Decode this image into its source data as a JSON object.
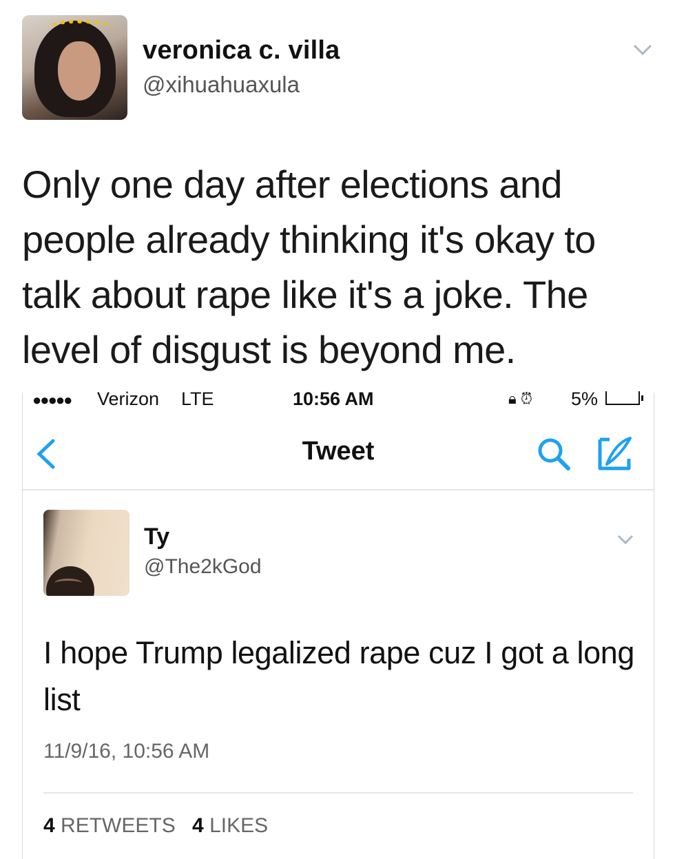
{
  "outer_tweet": {
    "name": "veronica c. villa",
    "handle": "@xihuahuaxula",
    "text": "Only one day after elections and people already thinking it's okay to talk about rape like it's a joke. The level of disgust is beyond me."
  },
  "screenshot": {
    "status_bar": {
      "signal": "●●●●●",
      "carrier": "Verizon",
      "network": "LTE",
      "time": "10:56 AM",
      "battery": "5%"
    },
    "nav": {
      "title": "Tweet"
    },
    "tweet": {
      "name": "Ty",
      "handle": "@The2kGod",
      "text": "I hope Trump legalized rape cuz I got a long list",
      "timestamp": "11/9/16, 10:56 AM",
      "retweets_count": "4",
      "retweets_label": "RETWEETS",
      "likes_count": "4",
      "likes_label": "LIKES"
    }
  },
  "icons": {
    "accent": "#1da1f2",
    "muted": "#aab8c2"
  }
}
